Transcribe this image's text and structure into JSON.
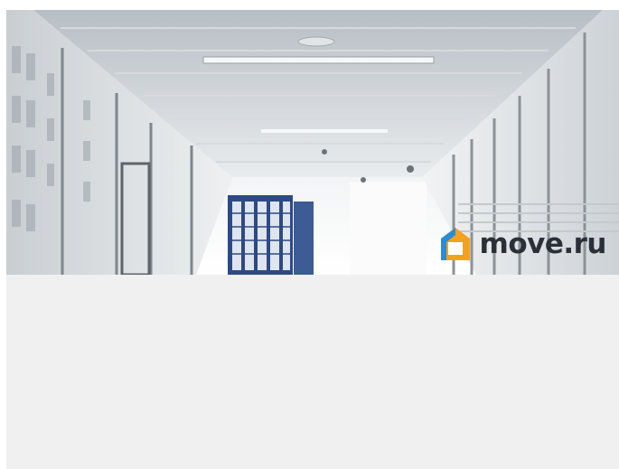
{
  "photo": {
    "alt_icon": "office-corridor-photo"
  },
  "brand": {
    "name": "move.ru",
    "icon": "house-logo-icon",
    "colors": {
      "orange": "#f4a21d",
      "blue": "#2a8bd8",
      "text": "#2b3038"
    }
  },
  "colors": {
    "background": "#f0f0f0"
  }
}
